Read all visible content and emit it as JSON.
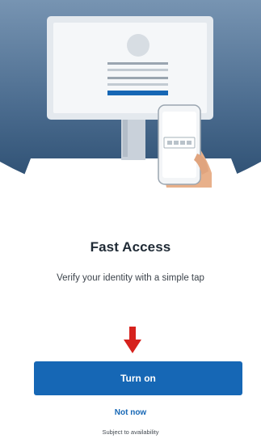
{
  "hero": {
    "illustration_icon": "computer-with-phone-verification-illustration",
    "colors": {
      "background_top": "#6f8cab",
      "background_bottom": "#2b4d70",
      "monitor_frame": "#e9edf1",
      "accent": "#1667b5"
    }
  },
  "content": {
    "title": "Fast Access",
    "subtitle": "Verify your identity with a simple tap"
  },
  "arrow": {
    "icon": "down-arrow-icon",
    "color": "#d6221d"
  },
  "actions": {
    "primary_label": "Turn on",
    "secondary_label": "Not now",
    "primary_color": "#1667b5"
  },
  "footer": {
    "note": "Subject to availability"
  }
}
